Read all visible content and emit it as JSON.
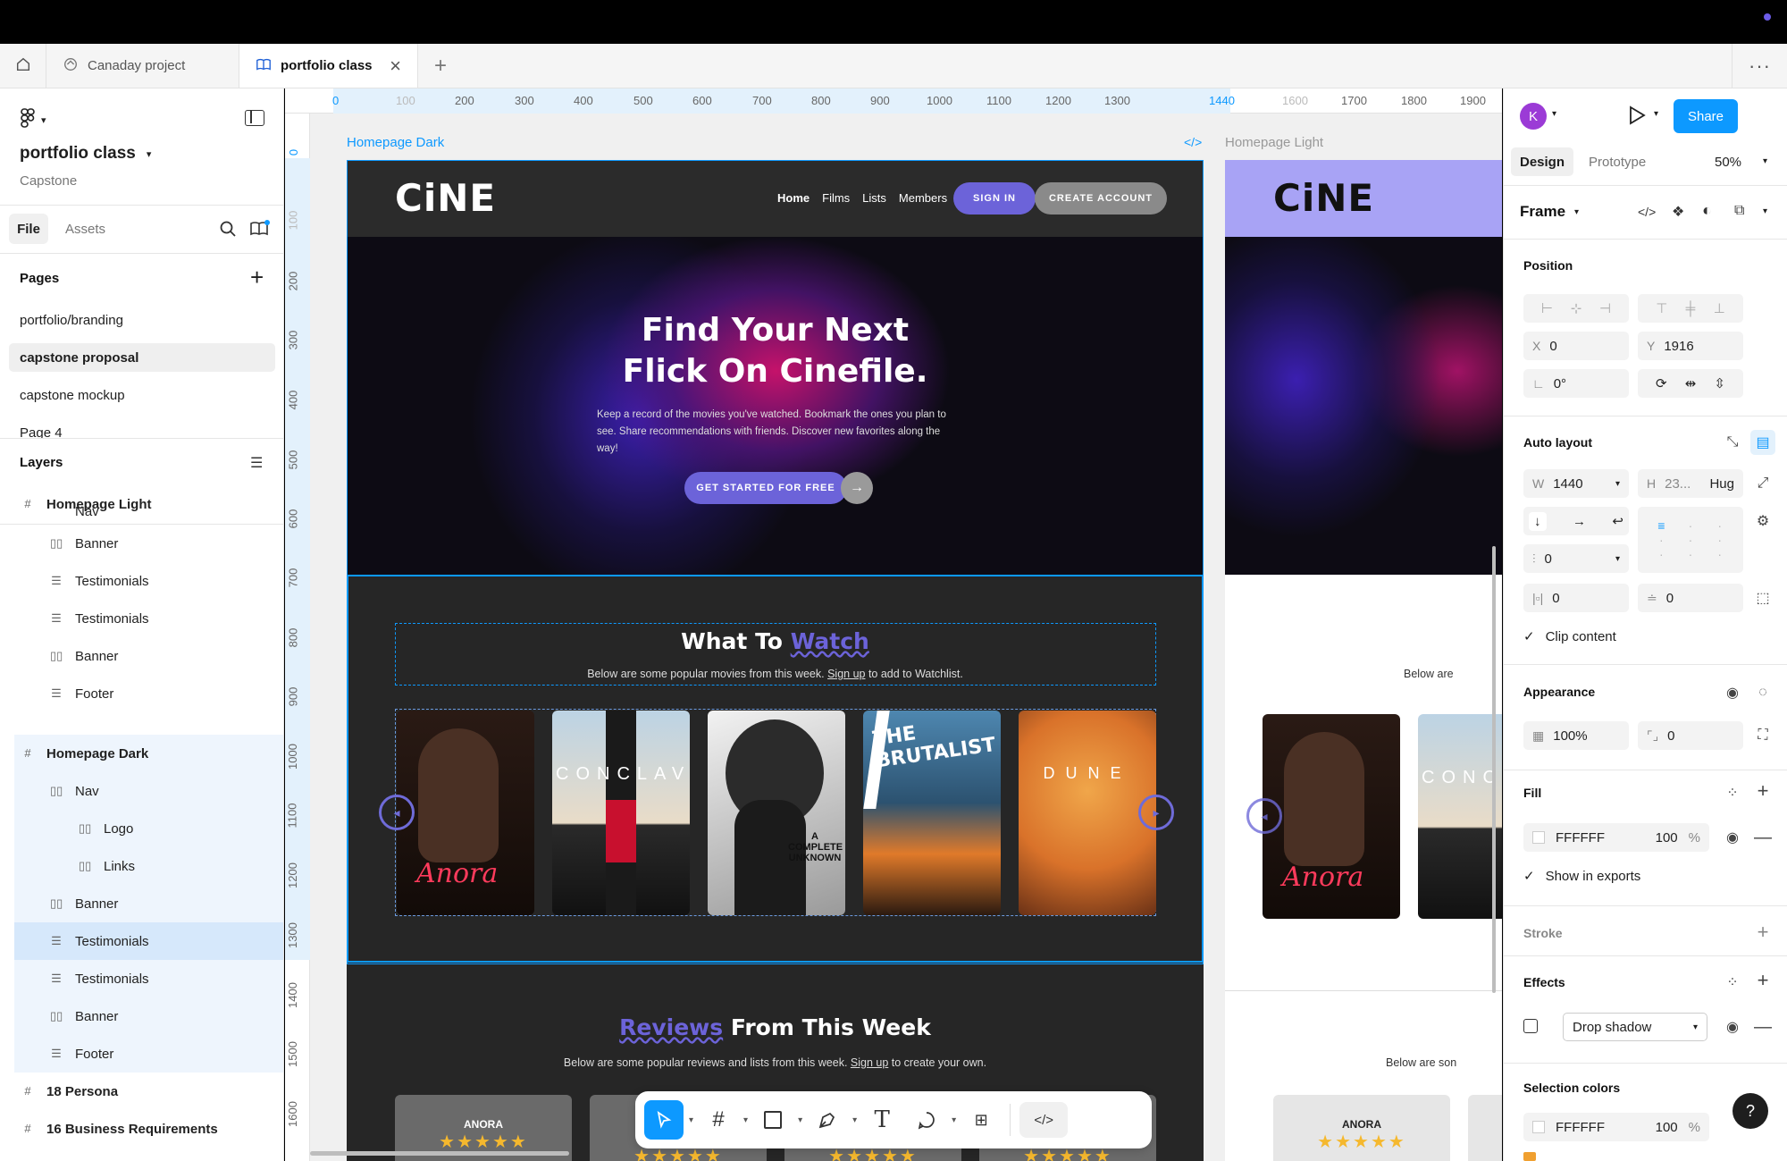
{
  "tabs": {
    "home_icon": "home-icon",
    "items": [
      {
        "label": "Canaday project"
      },
      {
        "label": "portfolio class"
      }
    ]
  },
  "left": {
    "file_name": "portfolio class",
    "file_sub": "Capstone",
    "file_tab": "File",
    "assets_tab": "Assets",
    "pages_title": "Pages",
    "pages": [
      "portfolio/branding",
      "capstone proposal",
      "capstone mockup",
      "Page 4"
    ],
    "layers_title": "Layers",
    "layers": [
      {
        "label": "Homepage Light",
        "type": "frame"
      },
      {
        "label": "Nav",
        "type": "frame"
      },
      {
        "label": "Banner",
        "type": "col"
      },
      {
        "label": "Testimonials",
        "type": "row"
      },
      {
        "label": "Testimonials",
        "type": "row"
      },
      {
        "label": "Banner",
        "type": "col"
      },
      {
        "label": "Footer",
        "type": "row"
      },
      {
        "label": "Homepage Dark",
        "type": "frame"
      },
      {
        "label": "Nav",
        "type": "col"
      },
      {
        "label": "Logo",
        "type": "col"
      },
      {
        "label": "Links",
        "type": "col"
      },
      {
        "label": "Banner",
        "type": "col"
      },
      {
        "label": "Testimonials",
        "type": "row"
      },
      {
        "label": "Testimonials",
        "type": "row"
      },
      {
        "label": "Banner",
        "type": "col"
      },
      {
        "label": "Footer",
        "type": "row"
      },
      {
        "label": "18 Persona",
        "type": "frame"
      },
      {
        "label": "16 Business Requirements",
        "type": "frame"
      }
    ]
  },
  "ruler": {
    "top": [
      "0",
      "100",
      "200",
      "300",
      "400",
      "500",
      "600",
      "700",
      "800",
      "900",
      "1000",
      "1100",
      "1200",
      "1300",
      "1440",
      "1600",
      "1700",
      "1800",
      "1900"
    ],
    "left": [
      "0",
      "100",
      "200",
      "300",
      "400",
      "500",
      "600",
      "700",
      "800",
      "900",
      "1000",
      "1100",
      "1200",
      "1300",
      "1400",
      "1500",
      "1600"
    ]
  },
  "canvas": {
    "frame_dark_label": "Homepage Dark",
    "frame_light_label": "Homepage Light",
    "logo": "CiNE",
    "nav": [
      "Home",
      "Films",
      "Lists",
      "Members"
    ],
    "sign_in": "SIGN IN",
    "create_account": "CREATE ACCOUNT",
    "hero_title_1": "Find Your Next",
    "hero_title_2": "Flick On Cinefile.",
    "hero_body": "Keep a record of the movies you've watched. Bookmark the ones you plan to see. Share recommendations with friends. Discover new favorites along the way!",
    "cta": "GET STARTED FOR FREE",
    "watch_title_a": "What To ",
    "watch_title_b": "Watch",
    "watch_sub_a": "Below are some popular movies from this week. ",
    "watch_sub_link": "Sign up",
    "watch_sub_b": " to add to Watchlist.",
    "posters": [
      "Anora",
      "CONCLAVE",
      "A COMPLETE UNKNOWN",
      "THE BRUTALIST",
      "DUNE"
    ],
    "reviews_title_a": "Reviews",
    "reviews_title_b": " From This Week",
    "reviews_sub_a": "Below are some popular reviews and lists from this week. ",
    "reviews_sub_link": "Sign up",
    "reviews_sub_b": " to create your own.",
    "review_card": "ANORA",
    "light_below": "Below are",
    "light_below2": "Below are son",
    "light_review": "ANORA"
  },
  "right": {
    "avatar": "K",
    "share": "Share",
    "design_tab": "Design",
    "prototype_tab": "Prototype",
    "zoom": "50%",
    "frame_label": "Frame",
    "position_title": "Position",
    "x_label": "X",
    "x_value": "0",
    "y_label": "Y",
    "y_value": "1916",
    "rotation": "0°",
    "auto_layout_title": "Auto layout",
    "w_label": "W",
    "w_value": "1440",
    "h_label": "H",
    "h_value": "23...",
    "h_mode": "Hug",
    "gap_value": "0",
    "pad_h": "0",
    "pad_v": "0",
    "clip_label": "Clip content",
    "appearance_title": "Appearance",
    "opacity": "100%",
    "radius": "0",
    "fill_title": "Fill",
    "fill_hex": "FFFFFF",
    "fill_opacity": "100",
    "pct": "%",
    "show_exports": "Show in exports",
    "stroke_title": "Stroke",
    "effects_title": "Effects",
    "effect_value": "Drop shadow",
    "selection_colors_title": "Selection colors",
    "sel_hex": "FFFFFF",
    "sel_opacity": "100"
  },
  "colors": {
    "accent": "#0d99ff",
    "purple": "#6c63d9",
    "dark_bg": "#262626"
  }
}
